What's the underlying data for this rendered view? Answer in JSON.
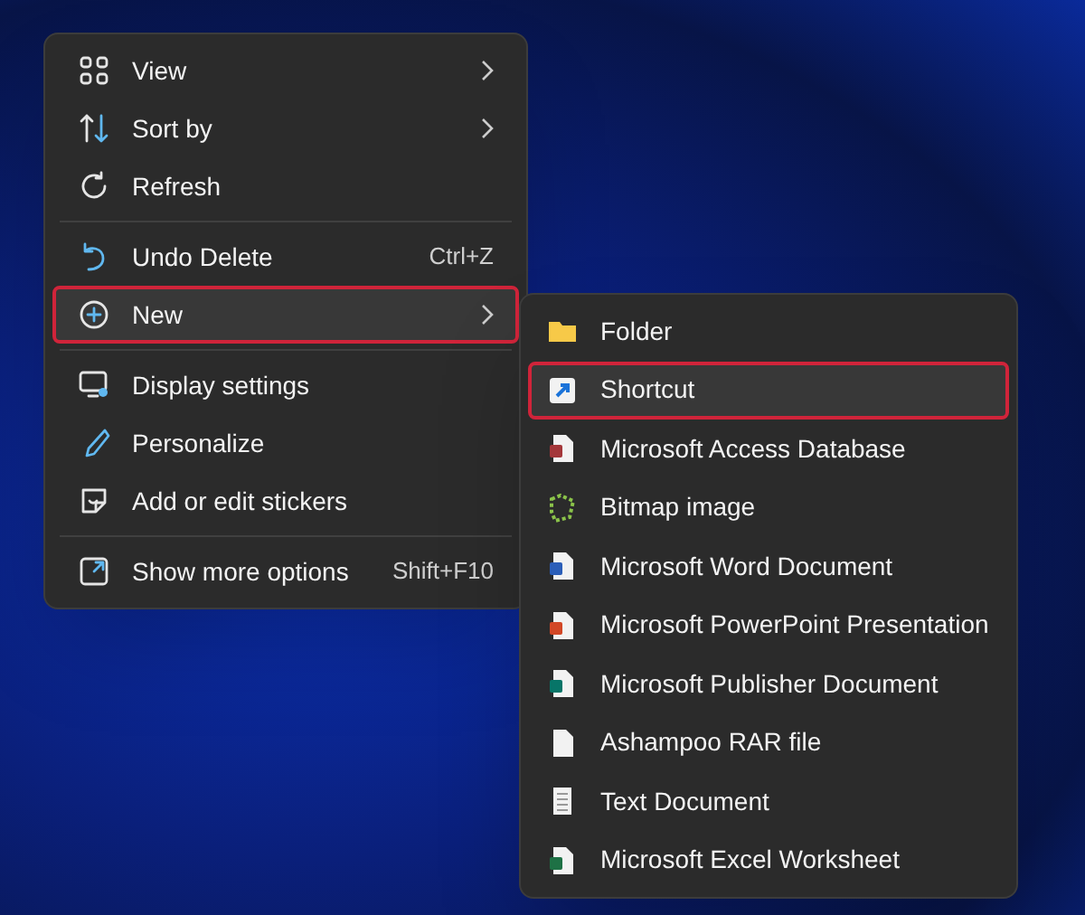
{
  "context_menu": {
    "groups": [
      [
        {
          "label": "View",
          "has_submenu": true,
          "highlighted": false
        },
        {
          "label": "Sort by",
          "has_submenu": true,
          "highlighted": false
        },
        {
          "label": "Refresh",
          "has_submenu": false,
          "highlighted": false
        }
      ],
      [
        {
          "label": "Undo Delete",
          "shortcut": "Ctrl+Z",
          "has_submenu": false,
          "highlighted": false
        },
        {
          "label": "New",
          "has_submenu": true,
          "highlighted": true
        }
      ],
      [
        {
          "label": "Display settings",
          "has_submenu": false,
          "highlighted": false
        },
        {
          "label": "Personalize",
          "has_submenu": false,
          "highlighted": false
        },
        {
          "label": "Add or edit stickers",
          "has_submenu": false,
          "highlighted": false
        }
      ],
      [
        {
          "label": "Show more options",
          "shortcut": "Shift+F10",
          "has_submenu": false,
          "highlighted": false
        }
      ]
    ]
  },
  "new_submenu": {
    "items": [
      {
        "label": "Folder",
        "highlighted": false
      },
      {
        "label": "Shortcut",
        "highlighted": true
      },
      {
        "label": "Microsoft Access Database",
        "highlighted": false
      },
      {
        "label": "Bitmap image",
        "highlighted": false
      },
      {
        "label": "Microsoft Word Document",
        "highlighted": false
      },
      {
        "label": "Microsoft PowerPoint Presentation",
        "highlighted": false
      },
      {
        "label": "Microsoft Publisher Document",
        "highlighted": false
      },
      {
        "label": "Ashampoo RAR file",
        "highlighted": false
      },
      {
        "label": "Text Document",
        "highlighted": false
      },
      {
        "label": "Microsoft Excel Worksheet",
        "highlighted": false
      }
    ]
  }
}
